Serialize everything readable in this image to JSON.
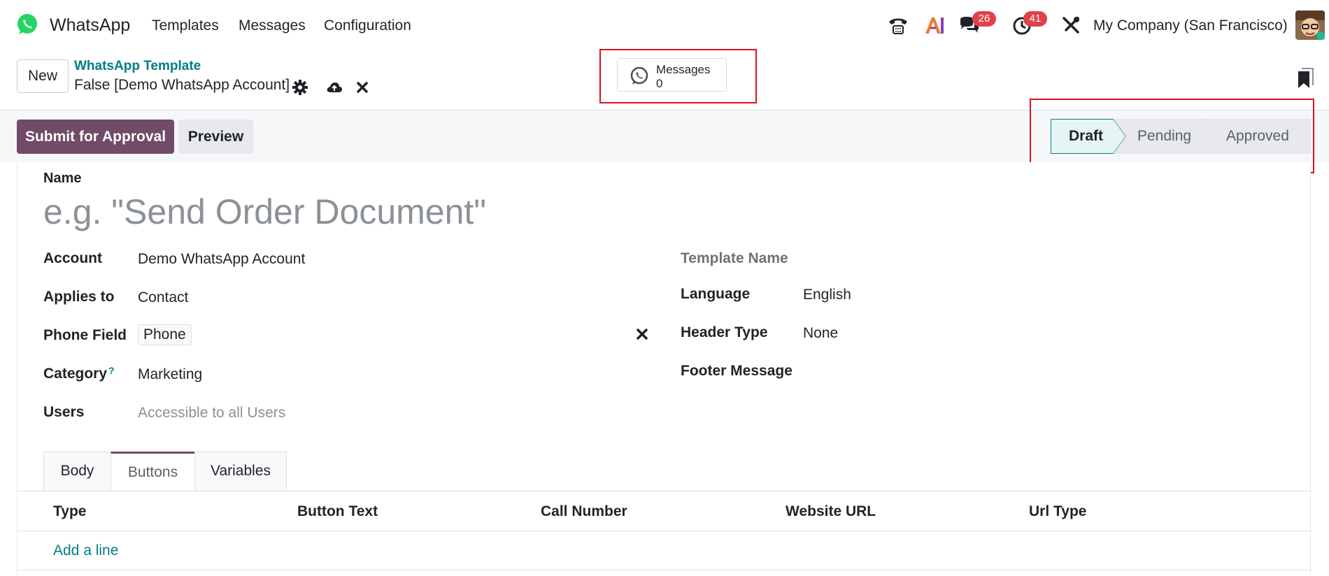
{
  "navbar": {
    "app_name": "WhatsApp",
    "menu": [
      "Templates",
      "Messages",
      "Configuration"
    ],
    "chat_count": "26",
    "activity_count": "41",
    "company": "My Company (San Francisco)",
    "brand_color": "#25d366"
  },
  "control": {
    "new_label": "New",
    "breadcrumb_parent": "WhatsApp Template",
    "breadcrumb_record": "False [Demo WhatsApp Account]",
    "smart_button": {
      "label": "Messages",
      "count": "0"
    }
  },
  "status": {
    "submit_label": "Submit for Approval",
    "preview_label": "Preview",
    "stages": [
      "Draft",
      "Pending",
      "Approved"
    ],
    "active_stage": "Draft",
    "primary_color": "#714b67"
  },
  "form": {
    "name_label": "Name",
    "name_placeholder": "e.g. \"Send Order Document\"",
    "account_label": "Account",
    "account_value": "Demo WhatsApp Account",
    "applies_label": "Applies to",
    "applies_value": "Contact",
    "phone_label": "Phone Field",
    "phone_value": "Phone",
    "category_label": "Category",
    "category_help": "?",
    "category_value": "Marketing",
    "users_label": "Users",
    "users_placeholder": "Accessible to all Users",
    "template_name_label": "Template Name",
    "language_label": "Language",
    "language_value": "English",
    "header_type_label": "Header Type",
    "header_type_value": "None",
    "footer_label": "Footer Message"
  },
  "tabs": [
    "Body",
    "Buttons",
    "Variables"
  ],
  "active_tab": "Buttons",
  "table": {
    "columns": [
      "Type",
      "Button Text",
      "Call Number",
      "Website URL",
      "Url Type"
    ],
    "add_line": "Add a line"
  }
}
